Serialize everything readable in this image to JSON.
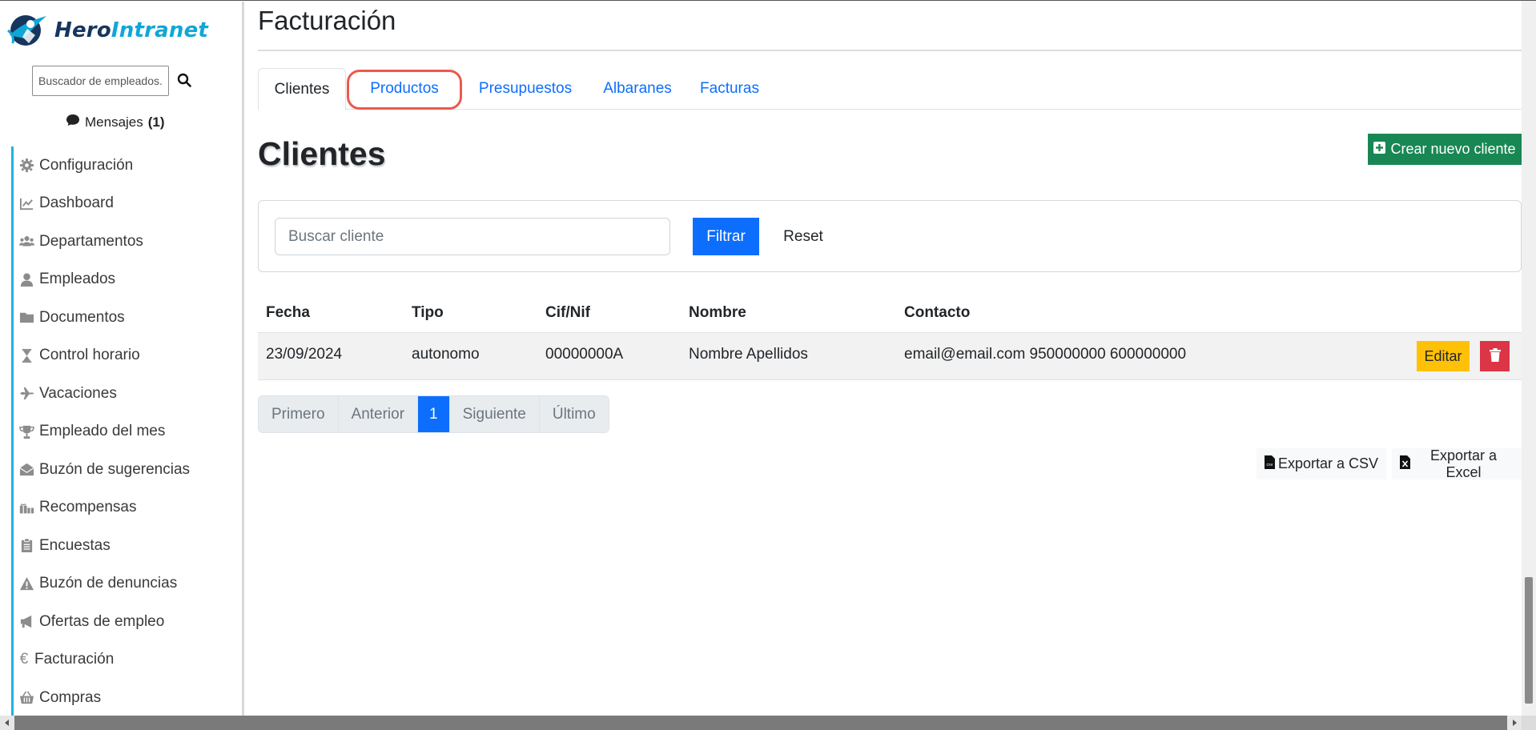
{
  "app": {
    "logo_part1": "Hero",
    "logo_part2": "Intranet"
  },
  "sidebar": {
    "search_placeholder": "Buscador de empleados...",
    "messages_label": "Mensajes",
    "messages_count": "(1)",
    "items": [
      {
        "label": "Configuración",
        "icon": "gear-icon"
      },
      {
        "label": "Dashboard",
        "icon": "chart-line-icon"
      },
      {
        "label": "Departamentos",
        "icon": "users-icon"
      },
      {
        "label": "Empleados",
        "icon": "user-icon"
      },
      {
        "label": "Documentos",
        "icon": "folder-icon"
      },
      {
        "label": "Control horario",
        "icon": "hourglass-icon"
      },
      {
        "label": "Vacaciones",
        "icon": "plane-icon"
      },
      {
        "label": "Empleado del mes",
        "icon": "trophy-icon"
      },
      {
        "label": "Buzón de sugerencias",
        "icon": "envelope-open-icon"
      },
      {
        "label": "Recompensas",
        "icon": "gifts-icon"
      },
      {
        "label": "Encuestas",
        "icon": "clipboard-list-icon"
      },
      {
        "label": "Buzón de denuncias",
        "icon": "warning-icon"
      },
      {
        "label": "Ofertas de empleo",
        "icon": "megaphone-icon"
      },
      {
        "label": "Facturación",
        "icon": "euro-icon"
      },
      {
        "label": "Compras",
        "icon": "basket-icon"
      }
    ]
  },
  "main": {
    "page_title": "Facturación",
    "tabs": [
      {
        "label": "Clientes",
        "active": true
      },
      {
        "label": "Productos",
        "active": false
      },
      {
        "label": "Presupuestos",
        "active": false
      },
      {
        "label": "Albaranes",
        "active": false
      },
      {
        "label": "Facturas",
        "active": false
      }
    ],
    "section_title": "Clientes",
    "create_button": "Crear nuevo cliente",
    "filter": {
      "search_placeholder": "Buscar cliente",
      "filter_button": "Filtrar",
      "reset_button": "Reset"
    },
    "table": {
      "headers": [
        "Fecha",
        "Tipo",
        "Cif/Nif",
        "Nombre",
        "Contacto"
      ],
      "rows": [
        {
          "fecha": "23/09/2024",
          "tipo": "autonomo",
          "cif": "00000000A",
          "nombre": "Nombre Apellidos",
          "contacto": "email@email.com 950000000 600000000",
          "edit_label": "Editar"
        }
      ]
    },
    "pagination": {
      "first": "Primero",
      "prev": "Anterior",
      "current": "1",
      "next": "Siguiente",
      "last": "Último"
    },
    "export_csv": "Exportar a CSV",
    "export_excel": "Exportar a Excel"
  },
  "colors": {
    "primary": "#0d6efd",
    "success": "#198754",
    "warning": "#ffc107",
    "danger": "#dc3545",
    "nav_accent": "#1fb3e0",
    "highlight": "#ea5a4c"
  }
}
